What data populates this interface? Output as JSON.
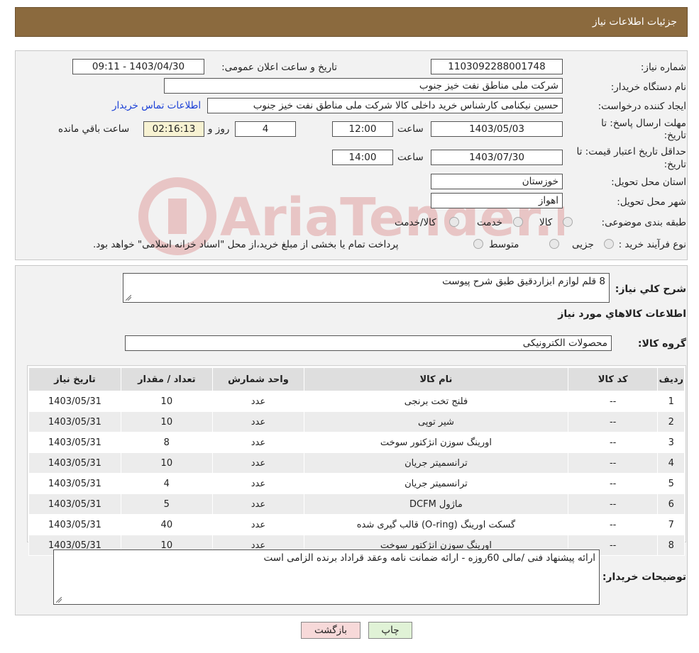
{
  "header": {
    "title": "جزئیات اطلاعات نیاز"
  },
  "form": {
    "need_number_label": "شماره نیاز:",
    "need_number": "1103092288001748",
    "announce_label": "تاریخ و ساعت اعلان عمومی:",
    "announce_value": "1403/04/30 - 09:11",
    "buyer_org_label": "نام دستگاه خریدار:",
    "buyer_org": "شرکت ملی مناطق نفت خیز جنوب",
    "creator_label": "ایجاد کننده درخواست:",
    "creator": "حسین  نیکنامی  کارشناس خرید داخلی کالا شرکت ملی مناطق نفت خیز جنوب",
    "contact_link": "اطلاعات تماس خریدار",
    "deadline_label_1": "مهلت ارسال پاسخ: تا",
    "deadline_label_2": "تاریخ:",
    "deadline_date": "1403/05/03",
    "time_label": "ساعت",
    "deadline_time": "12:00",
    "days_value": "4",
    "days_label": "روز و",
    "remaining_value": "02:16:13",
    "remaining_label": "ساعت باقي مانده",
    "validity_label_1": "حداقل تاریخ اعتبار قیمت: تا",
    "validity_label_2": "تاریخ:",
    "validity_date": "1403/07/30",
    "validity_time": "14:00",
    "province_label": "استان محل تحویل:",
    "province": "خوزستان",
    "city_label": "شهر محل تحویل:",
    "city": "اهواز",
    "category_label": "طبقه بندی موضوعی:",
    "category_options": [
      "کالا",
      "خدمت",
      "کالا/خدمت"
    ],
    "process_label": "نوع فرآیند خرید :",
    "process_options": [
      "جزیی",
      "متوسط"
    ],
    "process_note": "پرداخت تمام یا بخشی از مبلغ خرید،از محل \"اسناد خزانه اسلامی\" خواهد بود."
  },
  "details": {
    "summary_label": "شرح کلي نیاز:",
    "summary": "8 قلم لوازم ابزاردقیق طبق شرح پیوست",
    "items_title": "اطلاعات کالاهاي مورد نیاز",
    "group_label": "گروه کالا:",
    "group": "محصولات الکترونیکی"
  },
  "table": {
    "headers": [
      "ردیف",
      "کد کالا",
      "نام کالا",
      "واحد شمارش",
      "تعداد / مقدار",
      "تاریخ نیاز"
    ],
    "rows": [
      [
        "1",
        "--",
        "فلنج تخت برنجی",
        "عدد",
        "10",
        "1403/05/31"
      ],
      [
        "2",
        "--",
        "شیر توپی",
        "عدد",
        "10",
        "1403/05/31"
      ],
      [
        "3",
        "--",
        "اورینگ سوزن انژکتور سوخت",
        "عدد",
        "8",
        "1403/05/31"
      ],
      [
        "4",
        "--",
        "ترانسمیتر جریان",
        "عدد",
        "10",
        "1403/05/31"
      ],
      [
        "5",
        "--",
        "ترانسمیتر جریان",
        "عدد",
        "4",
        "1403/05/31"
      ],
      [
        "6",
        "--",
        "ماژول DCFM",
        "عدد",
        "5",
        "1403/05/31"
      ],
      [
        "7",
        "--",
        "گسکت اورینگ (O-ring) قالب گیری شده",
        "عدد",
        "40",
        "1403/05/31"
      ],
      [
        "8",
        "--",
        "اورینگ سوزن انژکتور سوخت",
        "عدد",
        "10",
        "1403/05/31"
      ]
    ]
  },
  "buyer_notes": {
    "label": "توضیحات خریدار:",
    "text": "ارائه پیشنهاد فنی /مالی 60روزه - ارائه ضمانت نامه وعقد قراداد برنده الزامی است"
  },
  "buttons": {
    "print": "چاپ",
    "back": "بازگشت"
  },
  "colors": {
    "header_bg": "#8b6a3e",
    "back_button_bg": "#f7d9d9",
    "print_button_bg": "#e0f2d6",
    "link": "#1a3fd6"
  },
  "watermark": {
    "text": "AriaTender.neT"
  }
}
